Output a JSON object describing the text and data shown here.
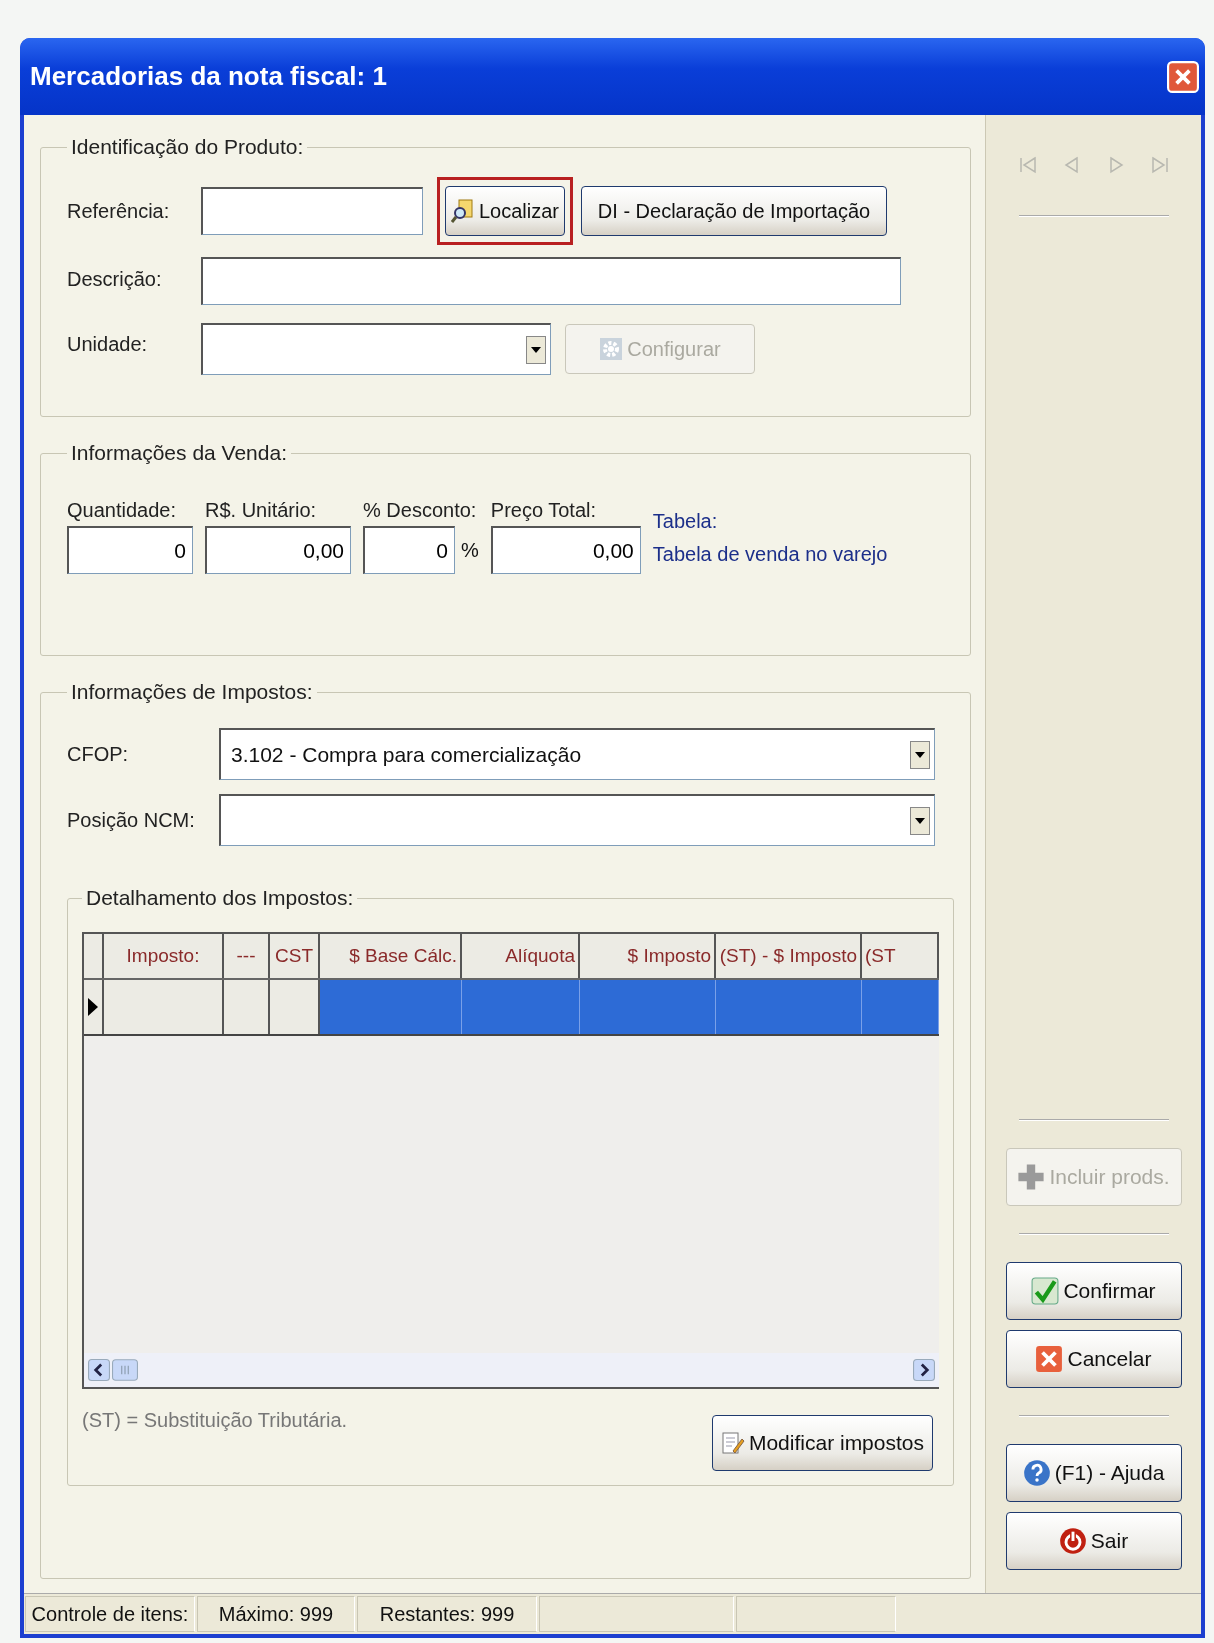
{
  "window": {
    "title": "Mercadorias da nota fiscal: 1"
  },
  "product": {
    "title": "Identificação do Produto:",
    "reference": {
      "label": "Referência:"
    },
    "find_button": {
      "label": "Localizar",
      "highlighted": true
    },
    "import_button": {
      "label": "DI - Declaração de Importação"
    },
    "description": {
      "label": "Descrição:"
    },
    "unit": {
      "label": "Unidade:"
    },
    "configure_button": {
      "label": "Configurar",
      "disabled": true
    }
  },
  "sale": {
    "title": "Informações da Venda:",
    "fields": [
      {
        "label": "Quantidade:",
        "value": "0"
      },
      {
        "label": "R$. Unitário:",
        "value": "0,00"
      },
      {
        "label": "% Desconto:",
        "value": "0",
        "suffix": "%"
      },
      {
        "label": "Preço Total:",
        "value": "0,00"
      }
    ],
    "table_label": "Tabela:",
    "table_value": "Tabela de venda no varejo"
  },
  "taxes": {
    "title": "Informações de Impostos:",
    "cfop": {
      "label": "CFOP:",
      "value": "3.102 - Compra para comercialização"
    },
    "ncm": {
      "label": "Posição NCM:"
    },
    "detail": {
      "title": "Detalhamento dos Impostos:",
      "columns": [
        "Imposto:",
        "---",
        "CST",
        "$ Base Cálc.",
        "Alíquota",
        "$ Imposto",
        "(ST) - $ Imposto",
        "(ST"
      ],
      "rows": [
        {
          "selected": true
        }
      ],
      "note": "(ST) = Substituição Tributária.",
      "modify_button": {
        "label": "Modificar impostos"
      }
    }
  },
  "sidebar": {
    "nav": [
      {
        "kind": "first",
        "disabled": true
      },
      {
        "kind": "prev",
        "disabled": true
      },
      {
        "kind": "next",
        "disabled": true
      },
      {
        "kind": "last",
        "disabled": true
      }
    ],
    "include_button": {
      "label": "Incluir prods.",
      "disabled": true
    },
    "confirm_button": {
      "label": "Confirmar"
    },
    "cancel_button": {
      "label": "Cancelar"
    },
    "help_button": {
      "label": "(F1) - Ajuda"
    },
    "exit_button": {
      "label": "Sair"
    }
  },
  "status_bar": [
    "Controle de itens:",
    "Máximo: 999",
    "Restantes: 999"
  ]
}
